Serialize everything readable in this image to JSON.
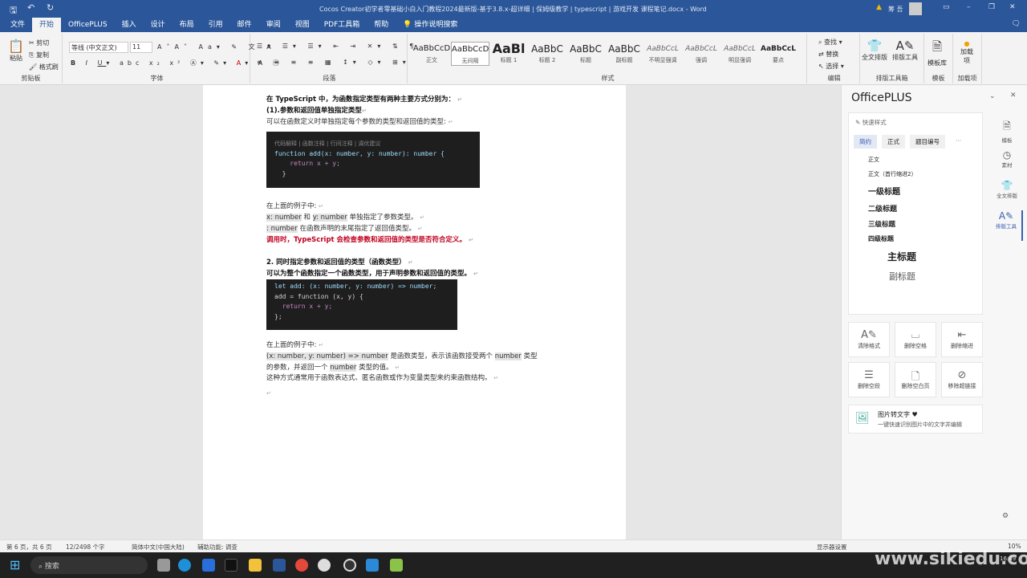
{
  "titlebar": {
    "title": "Cocos Creator初学者零基础小白入门教程2024最新版-基于3.8.x-超详细 | 保姆级教学 | typescript | 游戏开发 课程笔记.docx  -  Word",
    "user": "筹 吾",
    "quick_access": [
      "save-icon",
      "undo-icon",
      "redo-icon"
    ]
  },
  "tabs": [
    "文件",
    "开始",
    "OfficePLUS",
    "插入",
    "设计",
    "布局",
    "引用",
    "邮件",
    "审阅",
    "视图",
    "PDF工具箱",
    "帮助",
    "操作说明搜索"
  ],
  "ribbon": {
    "clipboard": {
      "paste": "粘贴",
      "cut": "剪切",
      "copy": "复制",
      "format_painter": "格式刷",
      "label": "剪贴板"
    },
    "font": {
      "name": "等线 (中文正文)",
      "size": "11",
      "label": "字体"
    },
    "paragraph": {
      "label": "段落"
    },
    "styles": {
      "label": "样式",
      "items": [
        {
          "preview": "AaBbCcD",
          "name": "正文"
        },
        {
          "preview": "AaBbCcD",
          "name": "无间隔"
        },
        {
          "preview": "AaBl",
          "name": "标题 1"
        },
        {
          "preview": "AaBbC",
          "name": "标题 2"
        },
        {
          "preview": "AaBbC",
          "name": "标题"
        },
        {
          "preview": "AaBbC",
          "name": "副标题"
        },
        {
          "preview": "AaBbCcL",
          "name": "不明显强调"
        },
        {
          "preview": "AaBbCcL",
          "name": "强调"
        },
        {
          "preview": "AaBbCcL",
          "name": "明显强调"
        },
        {
          "preview": "AaBbCcL",
          "name": "要点"
        }
      ]
    },
    "editing": {
      "find": "查找",
      "replace": "替换",
      "select": "选择",
      "label": "编辑"
    },
    "layout_tools": {
      "full": "全文排版",
      "tools": "排版工具",
      "label": "排版工具箱"
    },
    "template": {
      "lib": "模板库",
      "label": "模板"
    },
    "addins": {
      "add": "加载项",
      "label": "加载项"
    }
  },
  "doc": {
    "l1": "在 TypeScript 中，为函数指定类型有两种主要方式分别为：",
    "l2": "(1).参数和返回值单独指定类型",
    "l3": "可以在函数定义时单独指定每个参数的类型和返回值的类型:",
    "code1_hint": "代码解释 | 函数注释 | 行间注释 | 调优建议",
    "code1": [
      "function add(x: number, y: number): number {",
      "    return x + y;",
      "  }"
    ],
    "l4": "在上面的例子中:",
    "l5a": "x: number",
    "l5b": " 和 ",
    "l5c": "y: number",
    "l5d": " 单独指定了参数类型。",
    "l6a": ": number",
    "l6b": " 在函数声明的末尾指定了返回值类型。",
    "l7": "调用时，TypeScript 会检查参数和返回值的类型是否符合定义。",
    "l8": "2. 同时指定参数和返回值的类型（函数类型）",
    "l9": "可以为整个函数指定一个函数类型，用于声明参数和返回值的类型。",
    "code2": [
      "let add: (x: number, y: number) => number;",
      "add = function (x, y) {",
      "  return x + y;",
      "};"
    ],
    "l10": "在上面的例子中:",
    "l11a": "(x: number, y: number) => number",
    "l11b": " 是函数类型，表示该函数接受两个 ",
    "l11c": "number",
    "l11d": " 类型",
    "l12a": "的参数，并返回一个 ",
    "l12b": "number",
    "l12c": " 类型的值。",
    "l13": "这种方式通常用于函数表达式、匿名函数或作为变量类型来约束函数结构。"
  },
  "pane": {
    "title": "OfficePLUS",
    "quick_styles": "快速样式",
    "chips": [
      "简约",
      "正式",
      "题目编号",
      "···"
    ],
    "styles": [
      "正文",
      "正文（首行缩进2）",
      "一级标题",
      "二级标题",
      "三级标题",
      "四级标题",
      "主标题",
      "副标题"
    ],
    "side": [
      "模板",
      "素材",
      "全文排版",
      "排版工具"
    ],
    "tools": [
      "清除格式",
      "删除空格",
      "删除缩进",
      "删除空段",
      "删除空白页",
      "移除超链接"
    ],
    "ocr_title": "图片转文字",
    "ocr_desc": "一键快速识别图片中的文字并编辑"
  },
  "status": {
    "page": "第 6 页，共 6 页",
    "words": "12/2498 个字",
    "lang": "简体中文(中国大陆)",
    "access": "辅助功能: 调查",
    "display": "显示器设置",
    "zoom": "10%"
  },
  "taskbar": {
    "search": "搜索",
    "time": "16:49"
  },
  "watermark": "www.sikiedu.com"
}
